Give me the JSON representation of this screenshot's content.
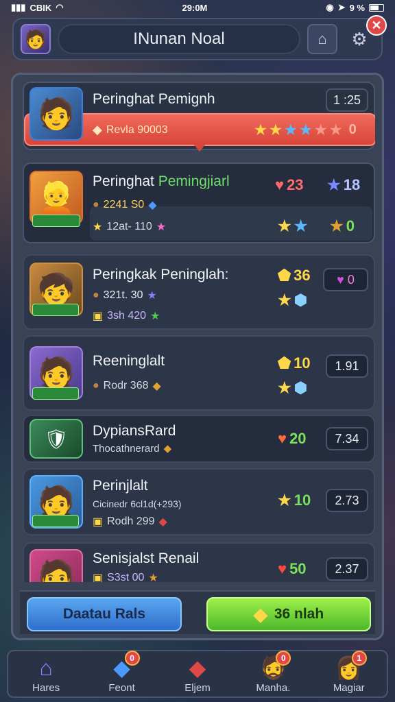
{
  "status": {
    "carrier": "CBIK",
    "time": "29:0M",
    "battery": "9 %"
  },
  "header": {
    "title": "INunan Noal",
    "avatar_icon": "player-avatar",
    "home_icon": "home-icon",
    "gear_icon": "gear-icon",
    "close_symbol": "✕"
  },
  "top_entry": {
    "name": "Peringhat Pemignh",
    "time": "1 :25",
    "reward": "Revla 90003",
    "stars_value": "0"
  },
  "rows": [
    {
      "name_main": "Peringhat ",
      "name_green": "Pemingjiarl",
      "sub1": "2241 S0",
      "sub2": "12at- 110",
      "stat_heart": "23",
      "stat_star": "18",
      "stat_right": "0"
    },
    {
      "name": "Peringkak Peninglah:",
      "sub1": "321t. 30",
      "sub2": "3sh 420",
      "stat_shield": "36",
      "stat_heart": "0"
    },
    {
      "name": "Reeninglalt",
      "sub1": "Rodr 368",
      "stat_shield": "10",
      "value": "1.91"
    },
    {
      "name": "DypiansRard",
      "sub1": "Thocathnerard",
      "stat_heart": "20",
      "value": "7.34"
    },
    {
      "name": "Perinjlalt",
      "sub1": "Cicinedr 6cl1d(+293)",
      "sub2": "Rodh 299",
      "stat_star": "10",
      "value": "2.73"
    },
    {
      "name": "Senisjalst Renail",
      "sub1": "S3st 00",
      "stat_heart": "50",
      "value": "2.37"
    }
  ],
  "buttons": {
    "left_label": "Daatau Rals",
    "right_label": "36 nlah"
  },
  "nav": [
    {
      "label": "Hares",
      "icon": "house-icon",
      "badge": ""
    },
    {
      "label": "Feont",
      "icon": "gem-icon",
      "badge": "0"
    },
    {
      "label": "Eljem",
      "icon": "red-gem-icon",
      "badge": ""
    },
    {
      "label": "Manha.",
      "icon": "character-icon",
      "badge": "0"
    },
    {
      "label": "Magiar",
      "icon": "character-icon",
      "badge": "1"
    }
  ]
}
